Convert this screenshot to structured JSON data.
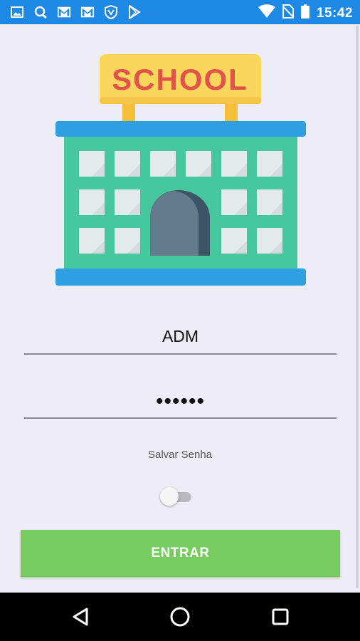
{
  "status_bar": {
    "time": "15:42",
    "left_icons": [
      "image-icon",
      "sync-icon",
      "gmail-icon",
      "gmail-icon",
      "shield-icon",
      "play-store-icon"
    ],
    "right_icons": [
      "wifi-icon",
      "no-sim-icon",
      "battery-icon"
    ],
    "color": "#1e88e5"
  },
  "logo": {
    "sign_text": "SCHOOL"
  },
  "form": {
    "username_value": "ADM",
    "password_value": "••••••",
    "save_password_label": "Salvar Senha",
    "save_password_on": false,
    "submit_label": "ENTRAR",
    "submit_color": "#76cc5f"
  },
  "nav_bar": {
    "buttons": [
      "back-icon",
      "home-icon",
      "recents-icon"
    ]
  }
}
